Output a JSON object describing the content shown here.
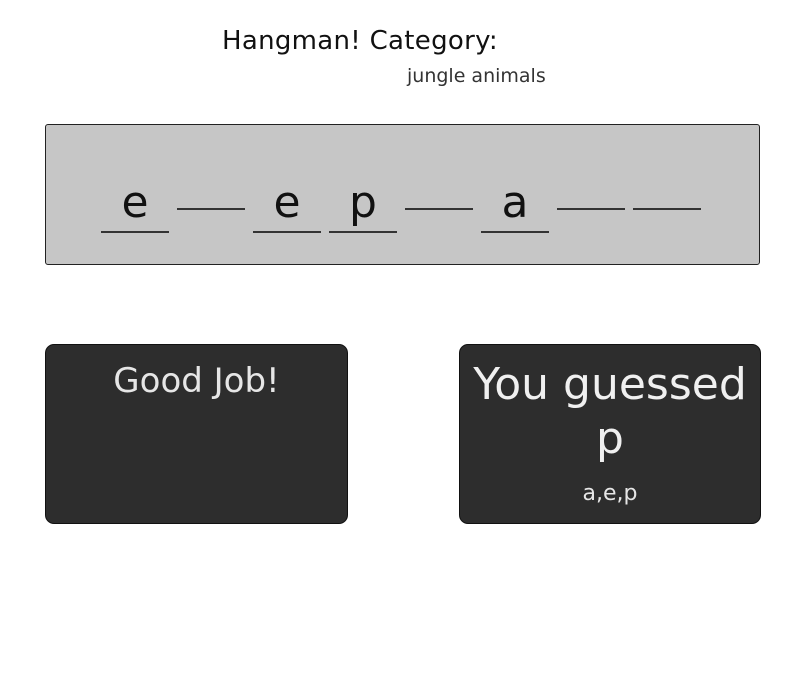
{
  "header": {
    "title": "Hangman! Category:",
    "category": "jungle animals"
  },
  "word": {
    "slots": [
      "e",
      "",
      "e",
      "p",
      "",
      "a",
      "",
      ""
    ]
  },
  "feedback": {
    "message": "Good Job!"
  },
  "guess": {
    "prefix": "You guessed",
    "letter": "p",
    "guessed_letters": "a,e,p"
  }
}
